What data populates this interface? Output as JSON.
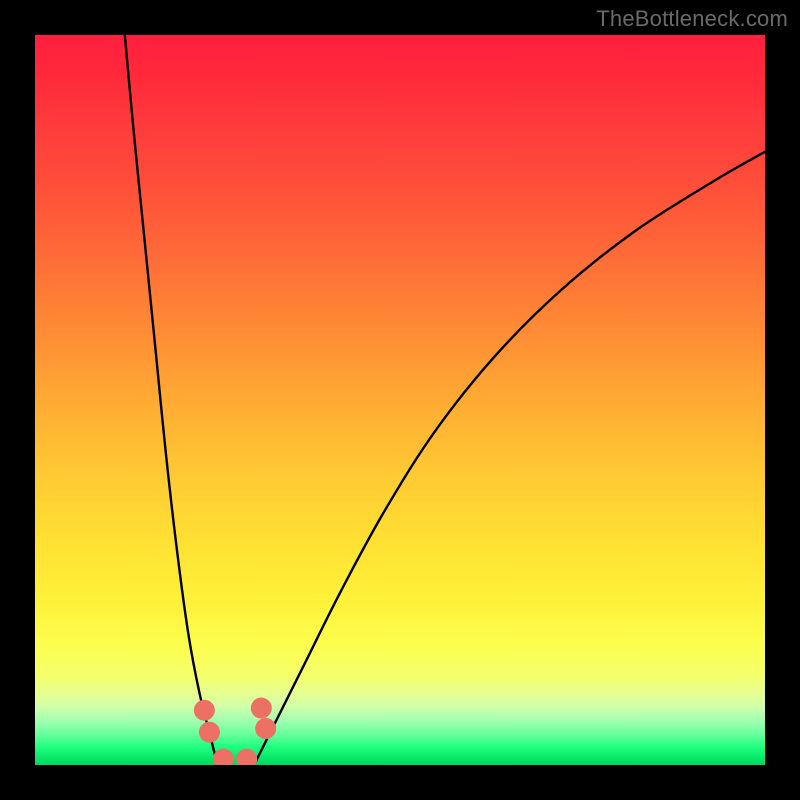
{
  "watermark": "TheBottleneck.com",
  "chart_data": {
    "type": "line",
    "title": "",
    "xlabel": "",
    "ylabel": "",
    "xlim": [
      0,
      100
    ],
    "ylim": [
      0,
      100
    ],
    "grid": false,
    "background_gradient": {
      "top": "#ff1f3f",
      "mid": "#ffd633",
      "bottom": "#00d860"
    },
    "series": [
      {
        "name": "left-branch",
        "x": [
          12.3,
          13.5,
          15,
          16.5,
          18,
          19.5,
          21,
          22.5,
          24,
          25
        ],
        "values": [
          100,
          87,
          72,
          57,
          42,
          29,
          18,
          10,
          4,
          0
        ],
        "color": "#000000"
      },
      {
        "name": "right-branch",
        "x": [
          30,
          33,
          37,
          42,
          48,
          55,
          63,
          72,
          82,
          93,
          100
        ],
        "values": [
          0,
          6,
          14,
          24,
          35,
          46,
          56,
          65,
          73,
          80,
          84
        ],
        "color": "#000000"
      }
    ],
    "annotations": [
      {
        "name": "marker-left-upper",
        "x": 23.2,
        "y": 7.5,
        "color": "#ec7063"
      },
      {
        "name": "marker-left-lower",
        "x": 23.9,
        "y": 4.5,
        "color": "#ec7063"
      },
      {
        "name": "marker-right-upper",
        "x": 31.0,
        "y": 7.8,
        "color": "#ec7063"
      },
      {
        "name": "marker-right-lower",
        "x": 31.6,
        "y": 5.0,
        "color": "#ec7063"
      },
      {
        "name": "marker-bottom-left",
        "x": 25.8,
        "y": 0.8,
        "color": "#ec7063"
      },
      {
        "name": "marker-bottom-right",
        "x": 29.0,
        "y": 0.8,
        "color": "#ec7063"
      }
    ]
  }
}
